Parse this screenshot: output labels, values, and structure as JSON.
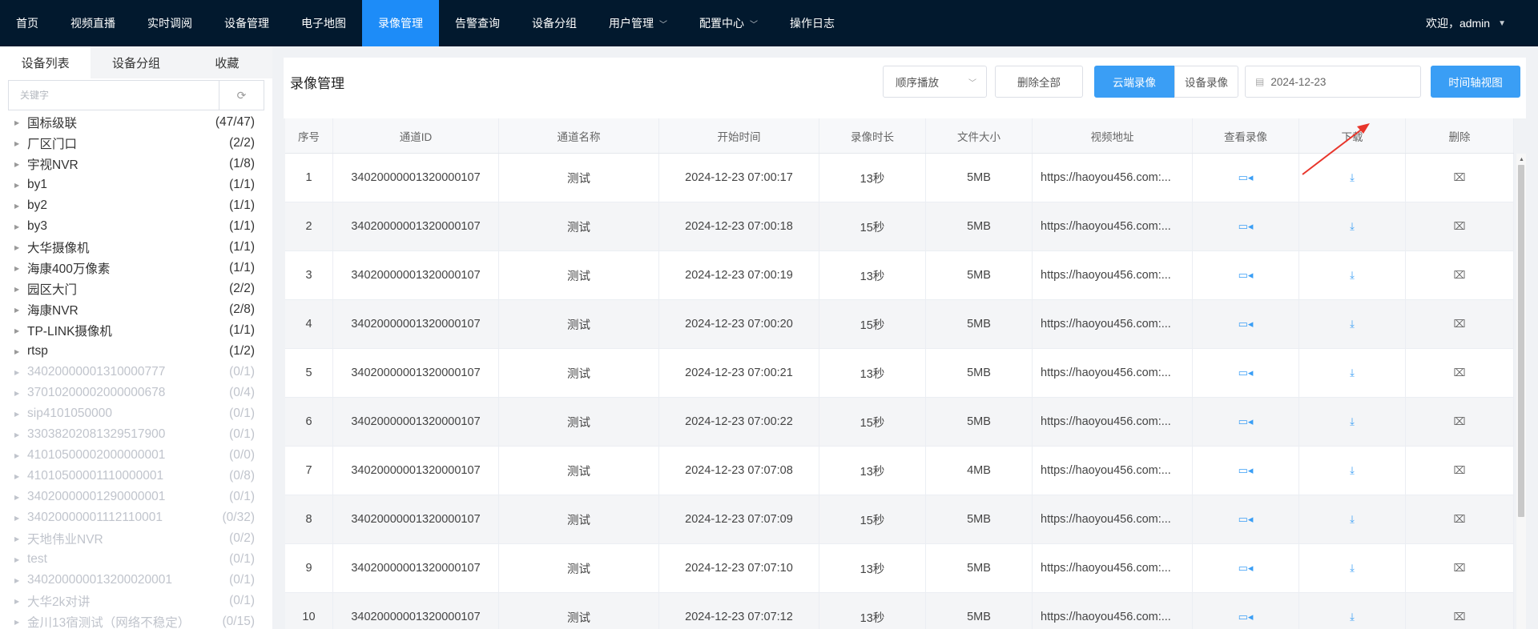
{
  "nav": {
    "items": [
      {
        "label": "首页",
        "active": false,
        "dropdown": false
      },
      {
        "label": "视频直播",
        "active": false,
        "dropdown": false
      },
      {
        "label": "实时调阅",
        "active": false,
        "dropdown": false
      },
      {
        "label": "设备管理",
        "active": false,
        "dropdown": false
      },
      {
        "label": "电子地图",
        "active": false,
        "dropdown": false
      },
      {
        "label": "录像管理",
        "active": true,
        "dropdown": false
      },
      {
        "label": "告警查询",
        "active": false,
        "dropdown": false
      },
      {
        "label": "设备分组",
        "active": false,
        "dropdown": false
      },
      {
        "label": "用户管理",
        "active": false,
        "dropdown": true
      },
      {
        "label": "配置中心",
        "active": false,
        "dropdown": true
      },
      {
        "label": "操作日志",
        "active": false,
        "dropdown": false
      }
    ],
    "welcome": "欢迎，admin"
  },
  "sidebar": {
    "tabs": [
      "设备列表",
      "设备分组",
      "收藏"
    ],
    "search_placeholder": "关键字",
    "tree": [
      {
        "name": "国标级联",
        "count": "(47/47)",
        "online": true
      },
      {
        "name": "厂区门口",
        "count": "(2/2)",
        "online": true
      },
      {
        "name": "宇视NVR",
        "count": "(1/8)",
        "online": true
      },
      {
        "name": "by1",
        "count": "(1/1)",
        "online": true
      },
      {
        "name": "by2",
        "count": "(1/1)",
        "online": true
      },
      {
        "name": "by3",
        "count": "(1/1)",
        "online": true
      },
      {
        "name": "大华摄像机",
        "count": "(1/1)",
        "online": true
      },
      {
        "name": "海康400万像素",
        "count": "(1/1)",
        "online": true
      },
      {
        "name": "园区大门",
        "count": "(2/2)",
        "online": true
      },
      {
        "name": "海康NVR",
        "count": "(2/8)",
        "online": true
      },
      {
        "name": "TP-LINK摄像机",
        "count": "(1/1)",
        "online": true
      },
      {
        "name": "rtsp",
        "count": "(1/2)",
        "online": true
      },
      {
        "name": "34020000001310000777",
        "count": "(0/1)",
        "online": false
      },
      {
        "name": "37010200002000000678",
        "count": "(0/4)",
        "online": false
      },
      {
        "name": "sip4101050000",
        "count": "(0/1)",
        "online": false
      },
      {
        "name": "33038202081329517900",
        "count": "(0/1)",
        "online": false
      },
      {
        "name": "41010500002000000001",
        "count": "(0/0)",
        "online": false
      },
      {
        "name": "41010500001110000001",
        "count": "(0/8)",
        "online": false
      },
      {
        "name": "34020000001290000001",
        "count": "(0/1)",
        "online": false
      },
      {
        "name": "34020000001112110001",
        "count": "(0/32)",
        "online": false
      },
      {
        "name": "天地伟业NVR",
        "count": "(0/2)",
        "online": false
      },
      {
        "name": "test",
        "count": "(0/1)",
        "online": false
      },
      {
        "name": "340200000013200020001",
        "count": "(0/1)",
        "online": false
      },
      {
        "name": "大华2k对讲",
        "count": "(0/1)",
        "online": false
      },
      {
        "name": "金川13宿测试（网络不稳定）",
        "count": "(0/15)",
        "online": false
      }
    ]
  },
  "main": {
    "title": "录像管理",
    "play_mode": "顺序播放",
    "delete_all": "删除全部",
    "cloud_record": "云端录像",
    "device_record": "设备录像",
    "date": "2024-12-23",
    "timeline_view": "时间轴视图",
    "columns": [
      "序号",
      "通道ID",
      "通道名称",
      "开始时间",
      "录像时长",
      "文件大小",
      "视频地址",
      "查看录像",
      "下载",
      "删除"
    ],
    "rows": [
      [
        "1",
        "34020000001320000107",
        "测试",
        "2024-12-23 07:00:17",
        "13秒",
        "5MB",
        "https://haoyou456.com:..."
      ],
      [
        "2",
        "34020000001320000107",
        "测试",
        "2024-12-23 07:00:18",
        "15秒",
        "5MB",
        "https://haoyou456.com:..."
      ],
      [
        "3",
        "34020000001320000107",
        "测试",
        "2024-12-23 07:00:19",
        "13秒",
        "5MB",
        "https://haoyou456.com:..."
      ],
      [
        "4",
        "34020000001320000107",
        "测试",
        "2024-12-23 07:00:20",
        "15秒",
        "5MB",
        "https://haoyou456.com:..."
      ],
      [
        "5",
        "34020000001320000107",
        "测试",
        "2024-12-23 07:00:21",
        "13秒",
        "5MB",
        "https://haoyou456.com:..."
      ],
      [
        "6",
        "34020000001320000107",
        "测试",
        "2024-12-23 07:00:22",
        "15秒",
        "5MB",
        "https://haoyou456.com:..."
      ],
      [
        "7",
        "34020000001320000107",
        "测试",
        "2024-12-23 07:07:08",
        "13秒",
        "4MB",
        "https://haoyou456.com:..."
      ],
      [
        "8",
        "34020000001320000107",
        "测试",
        "2024-12-23 07:07:09",
        "15秒",
        "5MB",
        "https://haoyou456.com:..."
      ],
      [
        "9",
        "34020000001320000107",
        "测试",
        "2024-12-23 07:07:10",
        "13秒",
        "5MB",
        "https://haoyou456.com:..."
      ],
      [
        "10",
        "34020000001320000107",
        "测试",
        "2024-12-23 07:07:12",
        "13秒",
        "5MB",
        "https://haoyou456.com:..."
      ]
    ],
    "icons": {
      "view": "video-camera-icon",
      "download": "download-icon",
      "delete": "trash-icon"
    }
  },
  "colors": {
    "nav_bg": "#02192e",
    "accent": "#1d8cf8",
    "primary_button": "#3a9ef5",
    "annotation_arrow": "#e8352b"
  }
}
